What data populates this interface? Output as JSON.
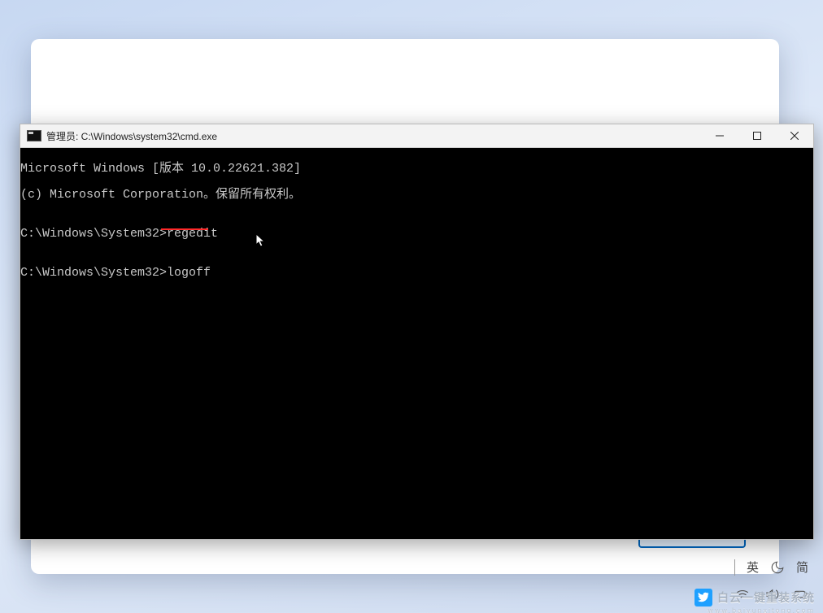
{
  "window": {
    "title": "管理员: C:\\Windows\\system32\\cmd.exe"
  },
  "terminal": {
    "line1": "Microsoft Windows [版本 10.0.22621.382]",
    "line2": "(c) Microsoft Corporation。保留所有权利。",
    "blank": "",
    "prompt1_path": "C:\\Windows\\System32>",
    "prompt1_cmd": "regedit",
    "prompt2_path": "C:\\Windows\\System32>",
    "prompt2_cmd": "logoff"
  },
  "tray": {
    "ime1": "英",
    "ime2": "简"
  },
  "watermark": {
    "text": "白云一键重装系统",
    "sub": "www.baiyunxitong.com"
  }
}
